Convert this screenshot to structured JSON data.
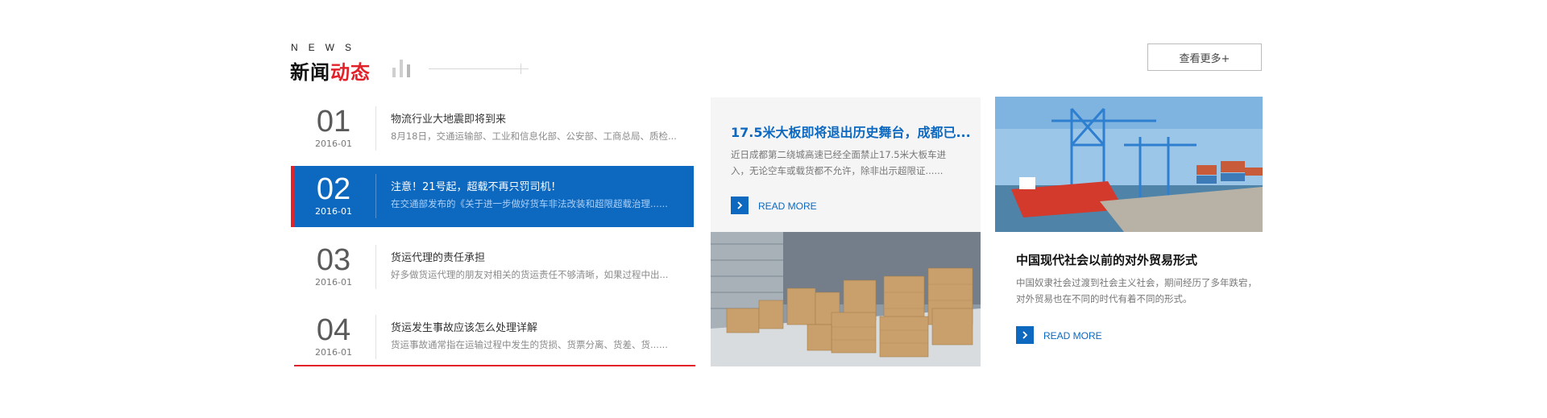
{
  "header": {
    "eyebrow": "NEWS",
    "title_main": "新闻",
    "title_accent": "动态",
    "more_label": "查看更多+"
  },
  "news_list": [
    {
      "num": "01",
      "date": "2016-01",
      "title": "物流行业大地震即将到来",
      "summary": "8月18日，交通运输部、工业和信息化部、公安部、工商总局、质检..."
    },
    {
      "num": "02",
      "date": "2016-01",
      "title": "注意！21号起，超载不再只罚司机！",
      "summary": "在交通部发布的《关于进一步做好货车非法改装和超限超载治理......"
    },
    {
      "num": "03",
      "date": "2016-01",
      "title": "货运代理的责任承担",
      "summary": "好多做货运代理的朋友对相关的货运责任不够清晰，如果过程中出..."
    },
    {
      "num": "04",
      "date": "2016-01",
      "title": "货运发生事故应该怎么处理详解",
      "summary": "货运事故通常指在运输过程中发生的货损、货票分离、货差、货......"
    }
  ],
  "featured_mid": {
    "title": "17.5米大板即将退出历史舞台，成都已...",
    "summary": "近日成都第二绕城高速已经全面禁止17.5米大板车进入，无论空车或载货都不允许，除非出示超限证......",
    "read_more": "READ MORE"
  },
  "featured_right": {
    "title": "中国现代社会以前的对外贸易形式",
    "summary": "中国奴隶社会过渡到社会主义社会，期间经历了多年跌宕，对外贸易也在不同的时代有着不同的形式。",
    "read_more": "READ MORE"
  },
  "colors": {
    "accent_red": "#e2222a",
    "brand_blue": "#0d68bf"
  }
}
